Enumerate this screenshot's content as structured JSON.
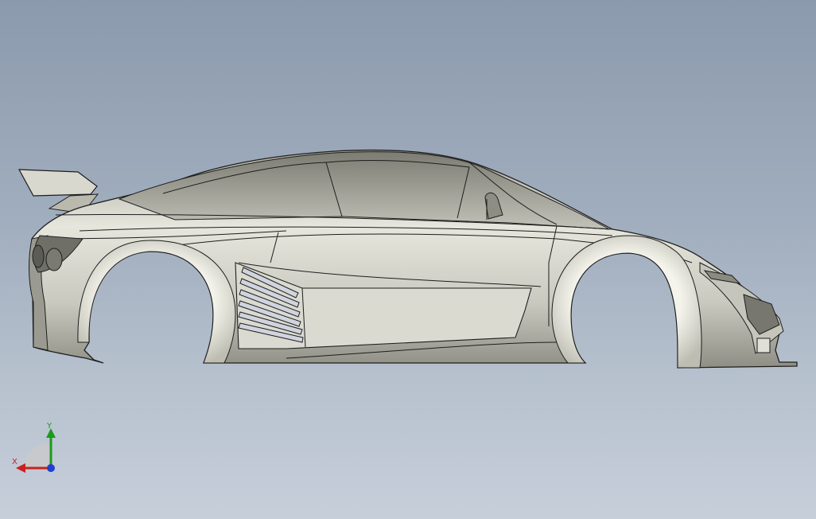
{
  "viewport": {
    "view": "side",
    "background_colors": {
      "top": "#8b9aad",
      "bottom": "#c6cfda"
    },
    "model": {
      "name": "car-body-shell",
      "body_color": "#d6d6cc",
      "edge_color": "#1e1e1e"
    }
  },
  "triad": {
    "x_label": "X",
    "y_label": "Y",
    "colors": {
      "x": "#cc1f1f",
      "y": "#1b9b1b",
      "z": "#1f3fcc"
    }
  }
}
